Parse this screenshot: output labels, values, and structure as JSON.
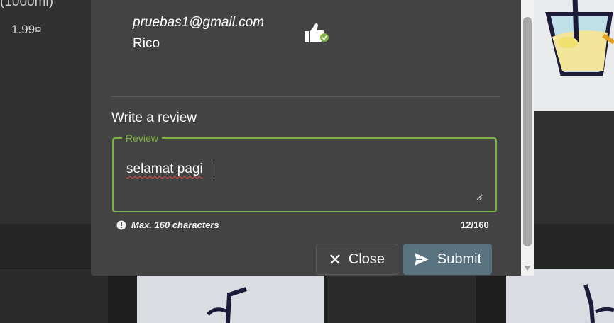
{
  "background": {
    "product_title_cut": "(1000ml)",
    "product_price": "1.99¤"
  },
  "modal": {
    "reviewer": {
      "email": "pruebas1@gmail.com",
      "review_text": "Rico",
      "rating_icon": "thumbs-up-icon"
    },
    "write_review": {
      "title": "Write a review",
      "field_label": "Review",
      "field_value": "selamat pagi",
      "hint": "Max. 160 characters",
      "hint_icon": "info-circle-icon",
      "counter": "12/160"
    },
    "actions": {
      "close_label": "Close",
      "close_icon": "close-icon",
      "submit_label": "Submit",
      "submit_icon": "send-icon"
    }
  },
  "colors": {
    "modal_bg": "#434343",
    "accent_green": "#7cb342",
    "submit_bg": "#58727f"
  }
}
